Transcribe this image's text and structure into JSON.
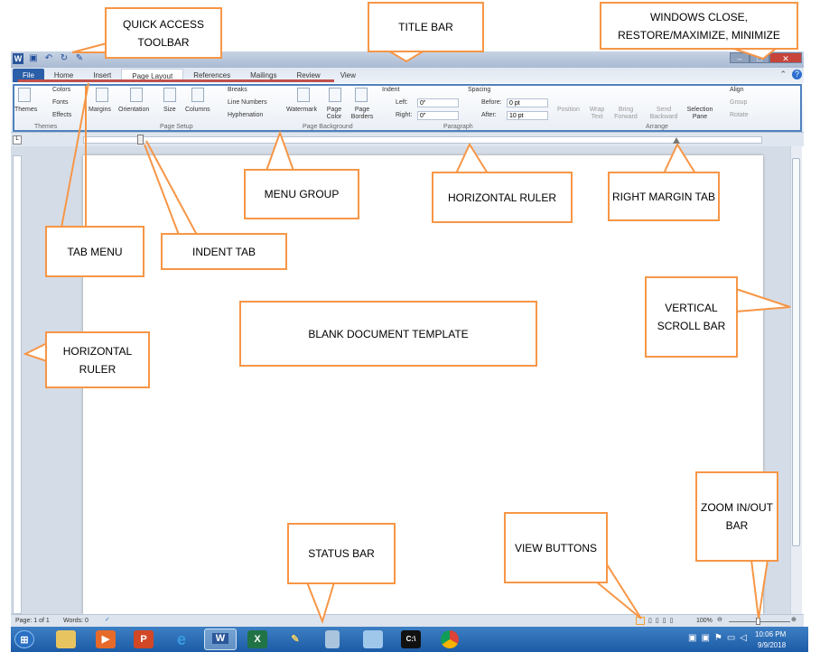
{
  "window": {
    "tabs": [
      "File",
      "Home",
      "Insert",
      "Page Layout",
      "References",
      "Mailings",
      "Review",
      "View"
    ],
    "active_tab": "Page Layout"
  },
  "ribbon": {
    "themes": {
      "themes": "Themes",
      "colors": "Colors",
      "fonts": "Fonts",
      "effects": "Effects",
      "label": "Themes"
    },
    "page_setup": {
      "margins": "Margins",
      "orientation": "Orientation",
      "size": "Size",
      "columns": "Columns",
      "breaks": "Breaks",
      "line_numbers": "Line Numbers",
      "hyphenation": "Hyphenation",
      "label": "Page Setup"
    },
    "page_background": {
      "watermark": "Watermark",
      "page_color": "Page Color",
      "page_borders": "Page Borders",
      "label": "Page Background"
    },
    "paragraph": {
      "indent": "Indent",
      "left_label": "Left:",
      "left_value": "0\"",
      "right_label": "Right:",
      "right_value": "0\"",
      "spacing": "Spacing",
      "before_label": "Before:",
      "before_value": "0 pt",
      "after_label": "After:",
      "after_value": "10 pt",
      "label": "Paragraph"
    },
    "arrange": {
      "position": "Position",
      "wrap_text": "Wrap Text",
      "bring_forward": "Bring Forward",
      "send_backward": "Send Backward",
      "selection_pane": "Selection Pane",
      "align": "Align",
      "group": "Group",
      "rotate": "Rotate",
      "label": "Arrange"
    }
  },
  "status": {
    "page": "Page: 1 of 1",
    "words": "Words: 0",
    "zoom": "100%"
  },
  "taskbar": {
    "time": "10:06 PM",
    "date": "9/9/2018"
  },
  "callouts": {
    "quick_access": "QUICK ACCESS TOOLBAR",
    "title_bar": "TITLE BAR",
    "window_controls": "WINDOWS CLOSE, RESTORE/MAXIMIZE, MINIMIZE",
    "menu_group": "MENU GROUP",
    "horizontal_ruler_top": "HORIZONTAL RULER",
    "right_margin_tab": "RIGHT MARGIN TAB",
    "tab_menu": "TAB MENU",
    "indent_tab": "INDENT TAB",
    "vertical_scroll_bar": "VERTICAL SCROLL BAR",
    "blank_document": "BLANK DOCUMENT TEMPLATE",
    "horizontal_ruler_left": "HORIZONTAL RULER",
    "status_bar": "STATUS BAR",
    "view_buttons": "VIEW BUTTONS",
    "zoom_bar": "ZOOM IN/OUT BAR"
  },
  "colors": {
    "callout_border": "#f79646",
    "ribbon_outline": "#4f81bd",
    "tab_underline": "#c0504d",
    "file_tab": "#2a5ea8"
  }
}
